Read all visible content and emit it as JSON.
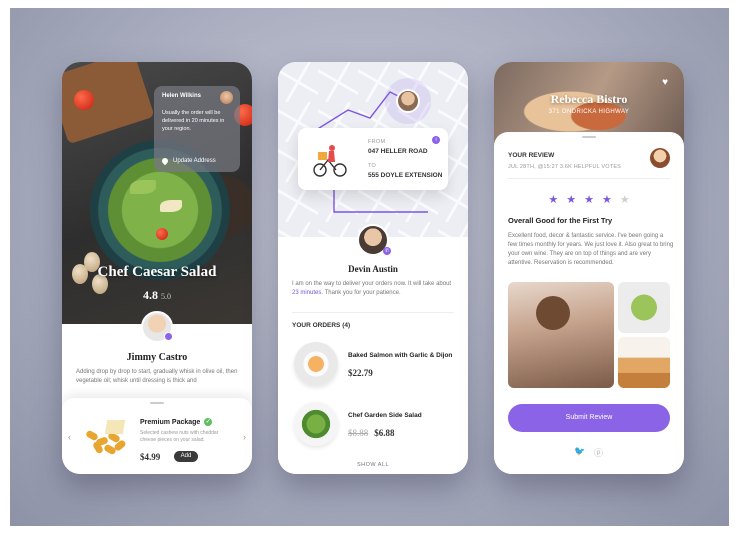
{
  "screen1": {
    "popup": {
      "name": "Helen Wilkins",
      "message": "Usually the order will be delivered in 20 minutes in your region.",
      "action": "Update Address"
    },
    "dish_title": "Chef Caesar Salad",
    "rating": "4.8",
    "rating_max": "5.0",
    "chef_name": "Jimmy Castro",
    "description": "Adding drop by drop to start, gradually whisk in olive oil, then vegetable oil; whisk until dressing is thick and",
    "package": {
      "title": "Premium Package",
      "description": "Selected cashew nuts with cheddar cheese pieces on your salad.",
      "price": "$4.99",
      "add_label": "Add"
    }
  },
  "screen2": {
    "from_label": "FROM",
    "from_address": "047 HELLER ROAD",
    "to_label": "TO",
    "to_address": "555 DOYLE EXTENSION",
    "driver_name": "Devin Austin",
    "message_pre": "I am on the way to deliver your orders now. It will take about ",
    "message_highlight": "23 minutes",
    "message_post": ". Thank you for your patience.",
    "orders_header": "YOUR ORDERS (4)",
    "orders": [
      {
        "name": "Baked Salmon with Garlic & Dijon",
        "old_price": "",
        "price": "$22.79"
      },
      {
        "name": "Chef Garden Side Salad",
        "old_price": "$8.88",
        "price": "$6.88"
      }
    ],
    "show_all": "SHOW ALL"
  },
  "screen3": {
    "restaurant": "Rebecca Bistro",
    "address": "371 ONDRICKA HIGHWAY",
    "review_header": "YOUR REVIEW",
    "review_meta": "JUL 28TH, @15:27   3.6K HELPFUL VOTES",
    "stars_filled": 4,
    "stars_total": 5,
    "review_title": "Overall Good for the First Try",
    "review_body": "Excellent food, decor & fantastic service. I've been going a few times monthly for years. We just love it. Also great to bring your own wine. They are on top of things and are very attentive. Reservation is recommended.",
    "submit_label": "Submit Review",
    "social_icons": [
      "twitter-icon",
      "pinterest-icon"
    ]
  },
  "colors": {
    "accent": "#8a63e6",
    "check": "#5ac05a"
  }
}
